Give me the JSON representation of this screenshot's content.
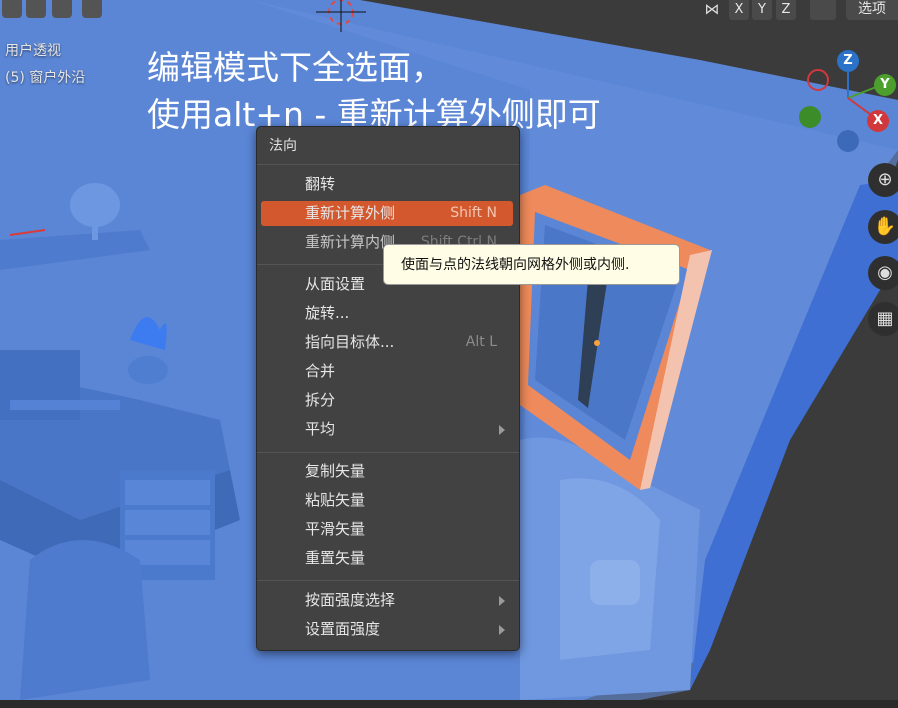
{
  "header": {
    "axis_buttons": [
      "X",
      "Y",
      "Z"
    ],
    "options_label": "选项"
  },
  "viewport": {
    "view_name": "用户透视",
    "object_info": "(5) 窗户外沿"
  },
  "caption": {
    "line1": "编辑模式下全选面，",
    "line2": "使用alt+n - 重新计算外侧即可"
  },
  "gizmo": {
    "z_label": "Z",
    "y_label": "Y",
    "x_label": "X",
    "colors": {
      "z": "#2b73c9",
      "y": "#4c9f2c",
      "x": "#d2373c"
    }
  },
  "nav_icons": [
    "zoom-icon",
    "hand-icon",
    "camera-icon",
    "grid-icon"
  ],
  "menu": {
    "title": "法向",
    "groups": [
      [
        {
          "label": "翻转",
          "shortcut": ""
        },
        {
          "label": "重新计算外侧",
          "shortcut": "Shift N",
          "active": true
        },
        {
          "label": "重新计算内侧",
          "shortcut": "Shift Ctrl N"
        }
      ],
      [
        {
          "label": "从面设置",
          "shortcut": ""
        },
        {
          "label": "旋转...",
          "shortcut": ""
        },
        {
          "label": "指向目标体...",
          "shortcut": "Alt L"
        },
        {
          "label": "合并",
          "shortcut": ""
        },
        {
          "label": "拆分",
          "shortcut": ""
        },
        {
          "label": "平均",
          "shortcut": "",
          "submenu": true
        }
      ],
      [
        {
          "label": "复制矢量",
          "shortcut": ""
        },
        {
          "label": "粘贴矢量",
          "shortcut": ""
        },
        {
          "label": "平滑矢量",
          "shortcut": ""
        },
        {
          "label": "重置矢量",
          "shortcut": ""
        }
      ],
      [
        {
          "label": "按面强度选择",
          "shortcut": "",
          "submenu": true
        },
        {
          "label": "设置面强度",
          "shortcut": "",
          "submenu": true
        }
      ]
    ]
  },
  "tooltip": {
    "text": "使面与点的法线朝向网格外侧或内侧."
  },
  "theme": {
    "accent": "#d4582e",
    "viewport_blue": "#5b86d6",
    "window_frame": "#ee8a5b"
  }
}
